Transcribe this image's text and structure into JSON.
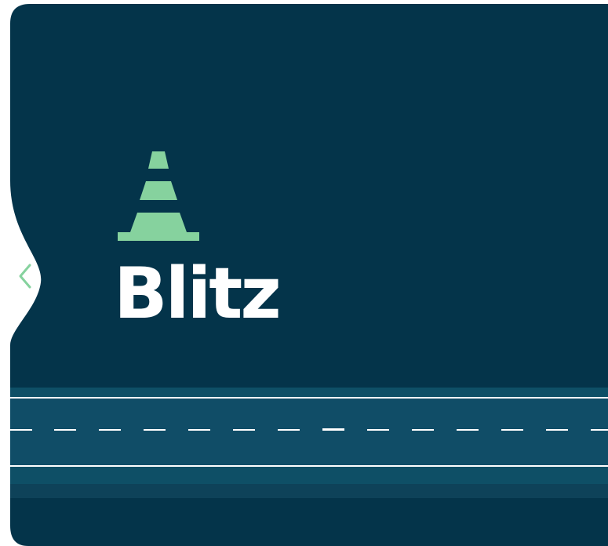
{
  "brand": {
    "name": "Blitz",
    "logo_icon": "traffic-cone-icon"
  },
  "navigation": {
    "back_icon": "chevron-left-icon"
  },
  "colors": {
    "background": "#04344a",
    "cone": "#86d29e",
    "title": "#ffffff",
    "road_edge": "#0e4f66",
    "road_surface": "#104d67",
    "road_lower": "#0e4259",
    "road_lines": "#ffffff",
    "chevron": "#86d29e"
  }
}
